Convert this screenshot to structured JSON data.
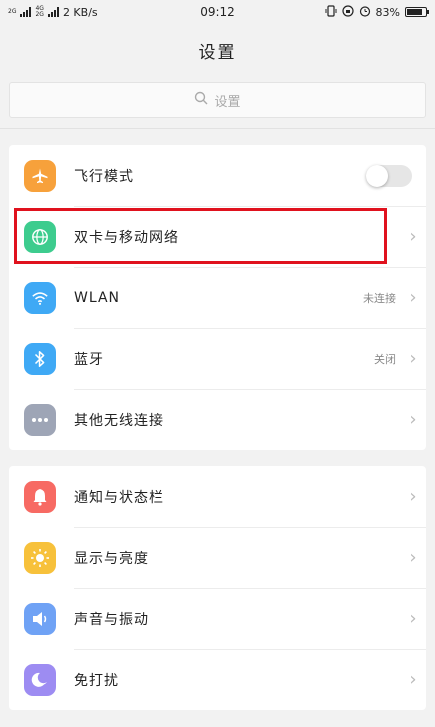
{
  "status_bar": {
    "left_network_1": "2G",
    "left_network_2": "4G",
    "left_network_3": "2G",
    "speed": "2 KB/s",
    "time": "09:12",
    "battery": "83%",
    "battery_level": 0.83
  },
  "header": {
    "title": "设置"
  },
  "search": {
    "placeholder": "设置"
  },
  "group1": {
    "items": [
      {
        "label": "飞行模式",
        "icon": "airplane-icon",
        "color": "#f7a13b",
        "toggle": false
      },
      {
        "label": "双卡与移动网络",
        "icon": "globe-icon",
        "color": "#3dcc8e"
      },
      {
        "label": "WLAN",
        "value": "未连接",
        "icon": "wifi-icon",
        "color": "#3fa9f5"
      },
      {
        "label": "蓝牙",
        "value": "关闭",
        "icon": "bluetooth-icon",
        "color": "#3fa9f5"
      },
      {
        "label": "其他无线连接",
        "icon": "more-icon",
        "color": "#9ea5b6"
      }
    ]
  },
  "group2": {
    "items": [
      {
        "label": "通知与状态栏",
        "icon": "bell-icon",
        "color": "#f76a63"
      },
      {
        "label": "显示与亮度",
        "icon": "sun-icon",
        "color": "#f7c13b"
      },
      {
        "label": "声音与振动",
        "icon": "speaker-icon",
        "color": "#6fa2f5"
      },
      {
        "label": "免打扰",
        "icon": "moon-icon",
        "color": "#9d8cf2"
      }
    ]
  }
}
